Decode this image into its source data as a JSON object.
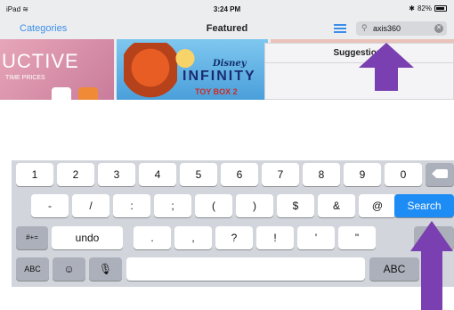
{
  "status_bar": {
    "device": "iPad",
    "wifi": "wifi-icon",
    "time": "3:24 PM",
    "bluetooth": "bluetooth-icon",
    "battery": "82%"
  },
  "nav": {
    "categories": "Categories",
    "title": "Featured",
    "search_value": "axis360"
  },
  "banner": {
    "promo_text": "UCTIVE",
    "promo_sub": "TIME PRICES",
    "disney": "Disney",
    "infinity": "INFINITY",
    "toybox": "TOY BOX 2"
  },
  "suggestions": {
    "heading": "Suggestions"
  },
  "keyboard": {
    "row1": [
      "1",
      "2",
      "3",
      "4",
      "5",
      "6",
      "7",
      "8",
      "9",
      "0"
    ],
    "row2": [
      "-",
      "/",
      ":",
      ";",
      "(",
      ")",
      "$",
      "&",
      "@"
    ],
    "search_label": "Search",
    "row3": [
      "#+=",
      "undo",
      ".",
      ",",
      "?",
      "!",
      "'",
      "\""
    ],
    "row4_left": [
      "ABC"
    ],
    "row4_right": "ABC"
  },
  "colors": {
    "accent": "#3b8eea",
    "search_key": "#1d8cf5",
    "arrow": "#7a3fb0"
  }
}
